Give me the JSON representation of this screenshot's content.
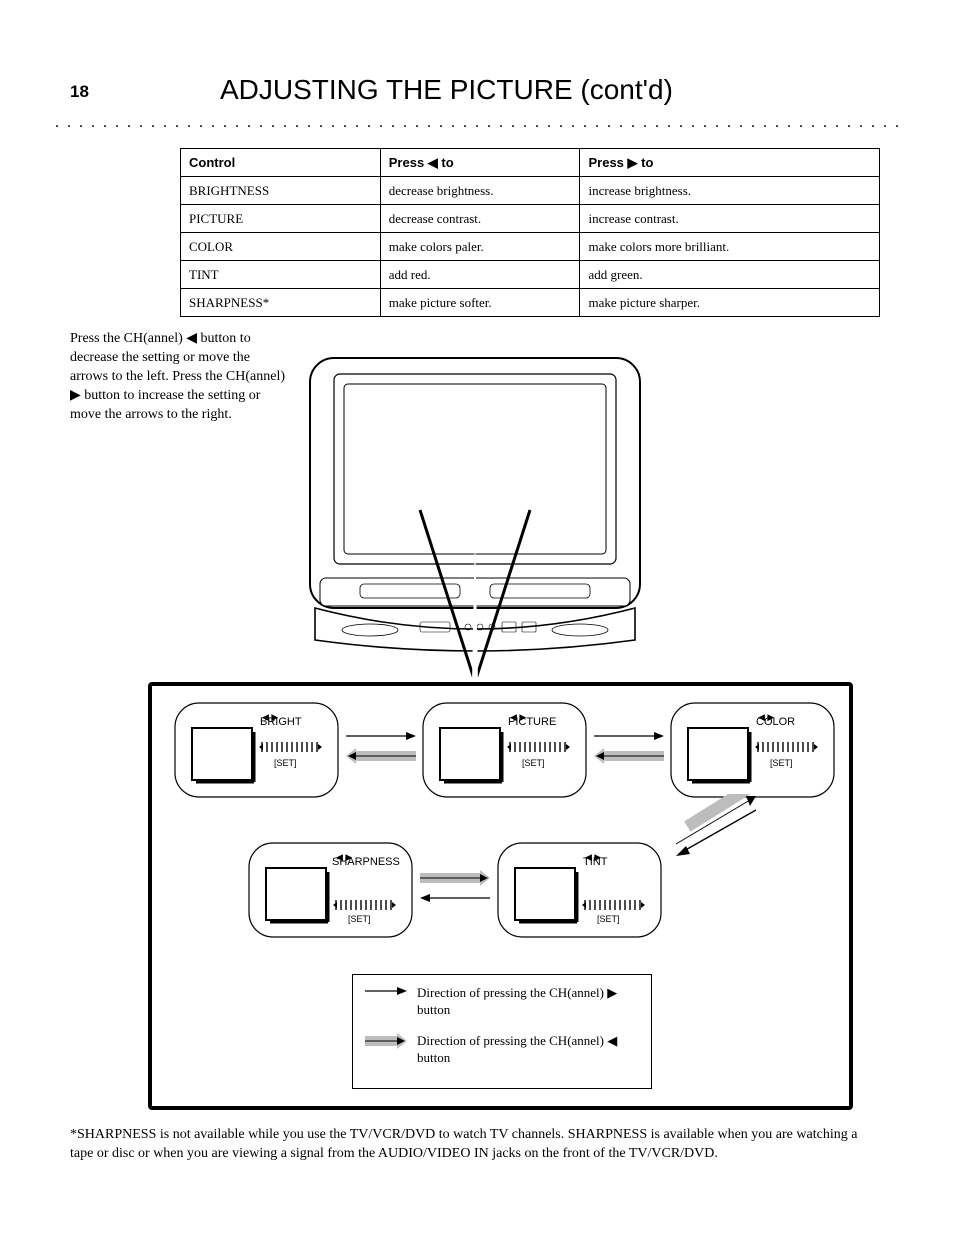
{
  "page_number": "18",
  "title": "ADJUSTING THE PICTURE (cont'd)",
  "table": {
    "head": [
      "Control",
      "Press ◀ to",
      "Press ▶ to"
    ],
    "rows": [
      [
        "BRIGHTNESS",
        "decrease brightness.",
        "increase brightness."
      ],
      [
        "PICTURE",
        "decrease contrast.",
        "increase contrast."
      ],
      [
        "COLOR",
        "make colors paler.",
        "make colors more brilliant."
      ],
      [
        "TINT",
        "add red.",
        "add green."
      ],
      [
        "SHARPNESS*",
        "make picture softer.",
        "make picture sharper."
      ]
    ]
  },
  "instructions": "Press the CH(annel) ◀ button to decrease the setting or move the arrows to the left. Press the CH(annel) ▶ button to increase the setting or move the arrows to the right.",
  "mini_screens": {
    "bright": {
      "label": "BRIGHT",
      "ticks_label": "[SET]"
    },
    "picture": {
      "label": "PICTURE",
      "ticks_label": "[SET]"
    },
    "color": {
      "label": "COLOR",
      "ticks_label": "[SET]"
    },
    "tint": {
      "label": "TINT",
      "ticks_label": "[SET]"
    },
    "sharp": {
      "label": "SHARPNESS",
      "ticks_label": "[SET]"
    }
  },
  "legend": {
    "white": "Direction of pressing the CH(annel) ▶ button",
    "gray": "Direction of pressing the CH(annel) ◀ button"
  },
  "footnote": "*SHARPNESS is not available while you use the TV/VCR/DVD to watch TV channels. SHARPNESS is available when you are watching a tape or disc or when you are viewing a signal from the AUDIO/VIDEO IN jacks on the front of the TV/VCR/DVD."
}
